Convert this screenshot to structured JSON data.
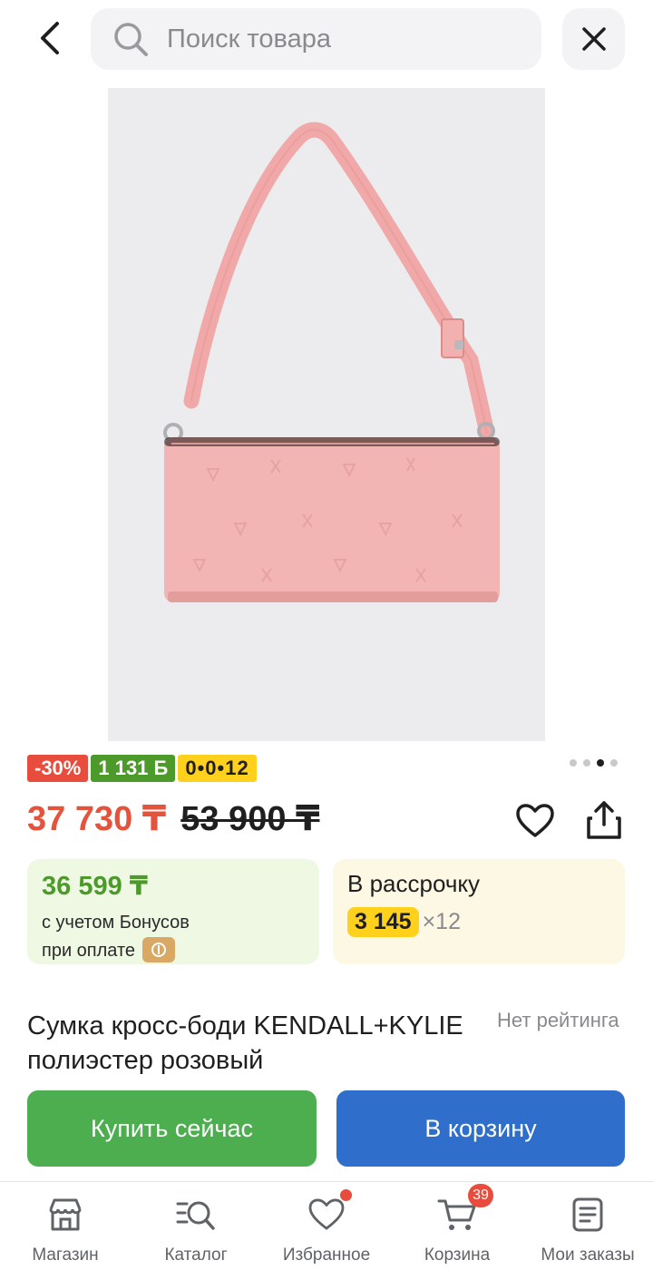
{
  "search": {
    "placeholder": "Поиск товара"
  },
  "badges": {
    "discount": "-30%",
    "bonus": "1 131 Б",
    "installment": "0•0•12"
  },
  "gallery": {
    "dots": 4,
    "active_index": 2
  },
  "price": {
    "current": "37 730 ₸",
    "old": "53 900 ₸"
  },
  "bonus_card": {
    "price": "36 599 ₸",
    "line1": "с учетом Бонусов",
    "line2": "при оплате"
  },
  "installment_card": {
    "title": "В рассрочку",
    "amount": "3 145",
    "term": "×12"
  },
  "product": {
    "title": "Сумка кросс-боди KENDALL+KYLIE полиэстер розовый",
    "rating": "Нет рейтинга"
  },
  "actions": {
    "buy_now": "Купить сейчас",
    "add_to_cart": "В корзину"
  },
  "nav": {
    "items": [
      {
        "label": "Магазин",
        "icon": "store-icon"
      },
      {
        "label": "Каталог",
        "icon": "catalog-search-icon"
      },
      {
        "label": "Избранное",
        "icon": "heart-icon"
      },
      {
        "label": "Корзина",
        "icon": "cart-icon",
        "badge": "39"
      },
      {
        "label": "Мои заказы",
        "icon": "orders-icon"
      }
    ]
  },
  "colors": {
    "price_red": "#e5533d",
    "bonus_green": "#4c9a2a",
    "installment_yellow": "#ffd11c",
    "buy_green": "#4cae4f",
    "cart_blue": "#2f6fcb",
    "bag_pink": "#f2b3b2"
  }
}
